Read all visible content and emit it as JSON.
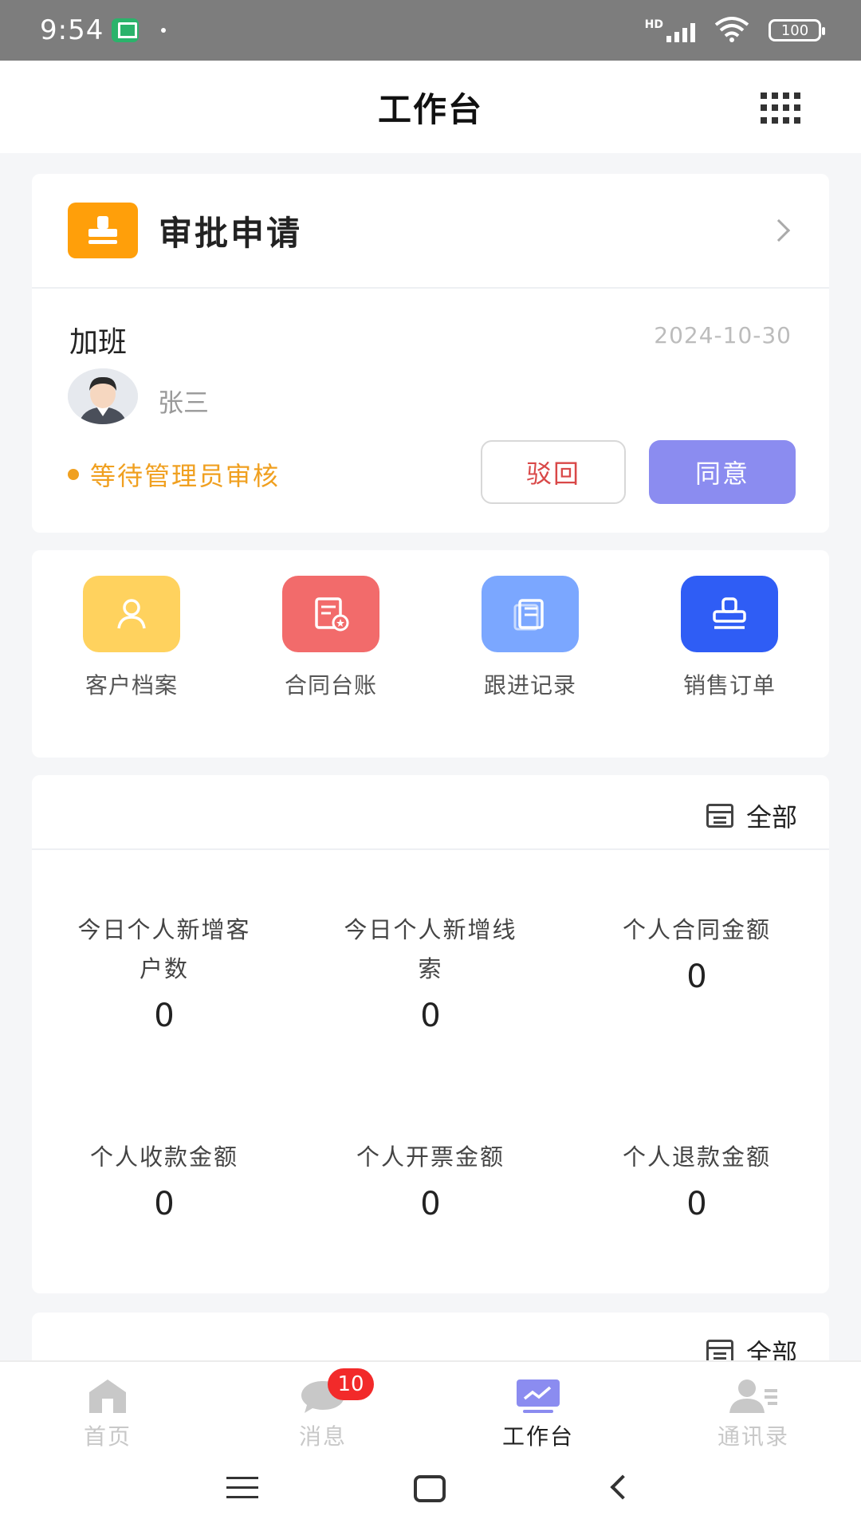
{
  "status_bar": {
    "time": "9:54",
    "network_label": "HD",
    "battery": "100"
  },
  "header": {
    "title": "工作台"
  },
  "approval": {
    "title": "审批申请",
    "request_type": "加班",
    "request_date": "2024-10-30",
    "applicant": "张三",
    "status_text": "等待管理员审核",
    "reject_label": "驳回",
    "agree_label": "同意"
  },
  "shortcuts": [
    {
      "label": "客户档案",
      "icon": "person-icon",
      "color": "#ffd25e"
    },
    {
      "label": "合同台账",
      "icon": "contract-icon",
      "color": "#f26b6b"
    },
    {
      "label": "跟进记录",
      "icon": "clipboard-icon",
      "color": "#7ba7ff"
    },
    {
      "label": "销售订单",
      "icon": "stamp-icon",
      "color": "#2f5df5"
    }
  ],
  "stats": {
    "filter_label": "全部",
    "items": [
      {
        "label_line1": "今日个人新增客",
        "label_line2": "户数",
        "value": "0"
      },
      {
        "label_line1": "今日个人新增线",
        "label_line2": "索",
        "value": "0"
      },
      {
        "label_line1": "个人合同金额",
        "label_line2": "",
        "value": "0"
      },
      {
        "label_line1": "个人收款金额",
        "label_line2": "",
        "value": "0"
      },
      {
        "label_line1": "个人开票金额",
        "label_line2": "",
        "value": "0"
      },
      {
        "label_line1": "个人退款金额",
        "label_line2": "",
        "value": "0"
      }
    ]
  },
  "stats2": {
    "filter_label": "全部"
  },
  "tabbar": {
    "items": [
      {
        "label": "首页",
        "icon": "home-icon",
        "active": false
      },
      {
        "label": "消息",
        "icon": "message-icon",
        "active": false,
        "badge": "10"
      },
      {
        "label": "工作台",
        "icon": "workbench-icon",
        "active": true
      },
      {
        "label": "通讯录",
        "icon": "contacts-icon",
        "active": false
      }
    ]
  },
  "colors": {
    "accent": "#8b8cf0",
    "warning": "#f0a020",
    "danger": "#d94848"
  }
}
